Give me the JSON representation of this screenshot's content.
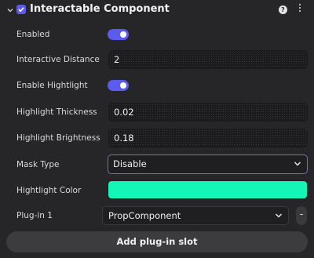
{
  "header": {
    "title": "Interactable Component",
    "enabled_checked": true,
    "help_glyph": "?"
  },
  "rows": {
    "enabled": {
      "label": "Enabled",
      "value": true
    },
    "interactive_distance": {
      "label": "Interactive Distance",
      "value": "2"
    },
    "enable_highlight": {
      "label": "Enable Hightlight",
      "value": true
    },
    "highlight_thickness": {
      "label": "Highlight Thickness",
      "value": "0.02"
    },
    "highlight_brightness": {
      "label": "Highlight Brightness",
      "value": "0.18"
    },
    "mask_type": {
      "label": "Mask Type",
      "value": "Disable"
    },
    "highlight_color": {
      "label": "Hightlight Color",
      "color": "#14f5b8"
    },
    "plugin_1": {
      "label": "Plug-in 1",
      "value": "PropComponent",
      "remove_glyph": "-"
    }
  },
  "add_plugin_label": "Add plug-in slot",
  "colors": {
    "accent": "#5b5bf0",
    "background": "#262628",
    "field": "#1b1b1d"
  }
}
